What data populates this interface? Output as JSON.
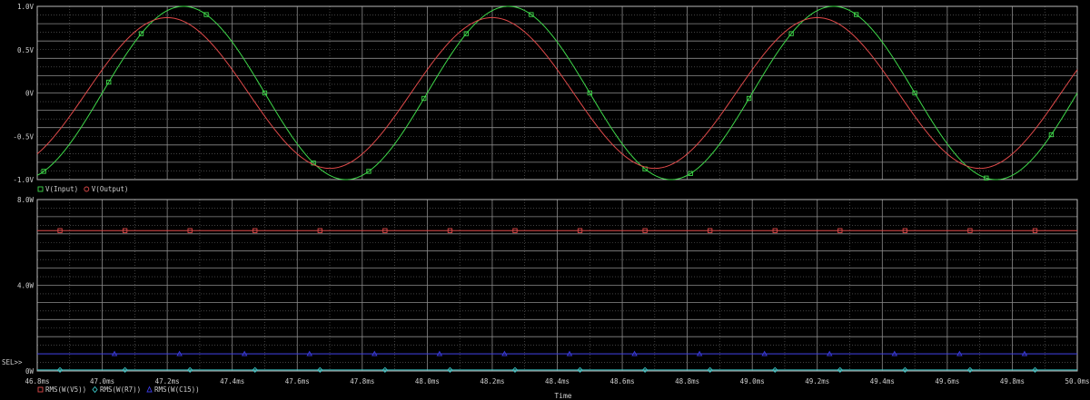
{
  "colors": {
    "background": "#000000",
    "frame": "#b8b8b8",
    "grid_dots": "#6a6a6a",
    "text": "#cfcfcf",
    "input": "#3fd94a",
    "output": "#e04a4a",
    "rms_v5": "#e04a4a",
    "rms_r7": "#39c4c4",
    "rms_c15": "#3a3ae0"
  },
  "chart_data": [
    {
      "type": "line",
      "xlim": [
        46.8,
        50.0
      ],
      "ylim": [
        -1.0,
        1.0
      ],
      "y_ticks": [
        {
          "value": 1.0,
          "label": "1.0V"
        },
        {
          "value": 0.5,
          "label": "0.5V"
        },
        {
          "value": 0.0,
          "label": "0V"
        },
        {
          "value": -0.5,
          "label": "-0.5V"
        },
        {
          "value": -1.0,
          "label": "-1.0V"
        }
      ],
      "grid": true,
      "legend_position": "bottom-left",
      "series": [
        {
          "name": "V(Input)",
          "marker": "square",
          "color_key": "input",
          "signal": {
            "waveform": "sine",
            "amplitude": 1.0,
            "frequency_khz": 1.0,
            "peak_at_ms": 47.25
          },
          "markers_x": [
            46.82,
            47.02,
            47.12,
            47.32,
            47.5,
            47.65,
            47.82,
            47.99,
            48.12,
            48.32,
            48.5,
            48.67,
            48.81,
            48.99,
            49.12,
            49.32,
            49.5,
            49.72,
            49.92
          ]
        },
        {
          "name": "V(Output)",
          "marker": "circle",
          "color_key": "output",
          "signal": {
            "waveform": "sine",
            "amplitude": 0.87,
            "frequency_khz": 1.0,
            "peak_at_ms": 47.2
          },
          "markers_x": []
        }
      ]
    },
    {
      "type": "line",
      "xlim": [
        46.8,
        50.0
      ],
      "ylim": [
        0.0,
        8.0
      ],
      "y_ticks": [
        {
          "value": 8.0,
          "label": "8.0W"
        },
        {
          "value": 4.0,
          "label": "4.0W"
        },
        {
          "value": 0.0,
          "label": "0W"
        }
      ],
      "x_ticks": [
        "46.8ms",
        "47.0ms",
        "47.2ms",
        "47.4ms",
        "47.6ms",
        "47.8ms",
        "48.0ms",
        "48.2ms",
        "48.4ms",
        "48.6ms",
        "48.8ms",
        "49.0ms",
        "49.2ms",
        "49.4ms",
        "49.6ms",
        "49.8ms",
        "50.0ms"
      ],
      "x_tick_values": [
        46.8,
        47.0,
        47.2,
        47.4,
        47.6,
        47.8,
        48.0,
        48.2,
        48.4,
        48.6,
        48.8,
        49.0,
        49.2,
        49.4,
        49.6,
        49.8,
        50.0
      ],
      "xlabel": "Time",
      "grid": true,
      "legend_position": "bottom-left",
      "selection_marker": "SEL>>",
      "series": [
        {
          "name": "RMS(W(V5))",
          "marker": "square",
          "color_key": "rms_v5",
          "value": 6.55,
          "markers_x": [
            46.87,
            47.07,
            47.27,
            47.47,
            47.67,
            47.87,
            48.07,
            48.27,
            48.47,
            48.67,
            48.87,
            49.07,
            49.27,
            49.47,
            49.67,
            49.87
          ]
        },
        {
          "name": "RMS(W(R7))",
          "marker": "diamond",
          "color_key": "rms_r7",
          "value": 0.05,
          "markers_x": [
            46.87,
            47.07,
            47.27,
            47.47,
            47.67,
            47.87,
            48.07,
            48.27,
            48.47,
            48.67,
            48.87,
            49.07,
            49.27,
            49.47,
            49.67,
            49.87
          ]
        },
        {
          "name": "RMS(W(C15))",
          "marker": "triangle",
          "color_key": "rms_c15",
          "value": 0.8,
          "markers_x": [
            46.87,
            47.07,
            47.27,
            47.47,
            47.67,
            47.87,
            48.07,
            48.27,
            48.47,
            48.67,
            48.87,
            49.07,
            49.27,
            49.47,
            49.67,
            49.87
          ]
        }
      ]
    }
  ]
}
